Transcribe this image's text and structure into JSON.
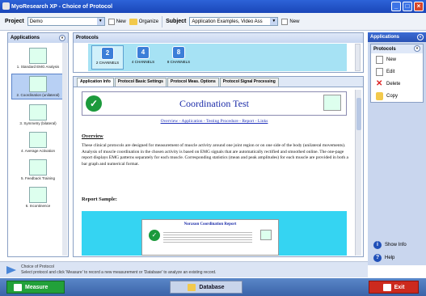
{
  "window": {
    "title": "MyoResearch XP - Choice of Protocol"
  },
  "toolbar": {
    "project_label": "Project",
    "project_value": "Demo",
    "new_label": "New",
    "organize_label": "Organize",
    "subject_label": "Subject",
    "subject_value": "Application Examples, Video Ass",
    "new2_label": "New"
  },
  "applications": {
    "header": "Applications",
    "items": [
      {
        "label": "1. Standard EMG Analysis"
      },
      {
        "label": "2. Coordination (unilateral)"
      },
      {
        "label": "3. Symmetry (bilateral)"
      },
      {
        "label": "4. Average Activation"
      },
      {
        "label": "5. Feedback Training"
      },
      {
        "label": "6. Incontinence"
      }
    ]
  },
  "protocols": {
    "header": "Protocols",
    "items": [
      {
        "label": "2 CHANNELS",
        "badge": "2"
      },
      {
        "label": "4 CHANNELS",
        "badge": "4"
      },
      {
        "label": "8 CHANNELS",
        "badge": "8"
      }
    ]
  },
  "tabs": [
    {
      "label": "Application Info"
    },
    {
      "label": "Protocol Basic Settings"
    },
    {
      "label": "Protocol Meas. Options"
    },
    {
      "label": "Protocol Signal Processing"
    }
  ],
  "content": {
    "title": "Coordination Test",
    "nav": "Overview - Application - Testing Procedure - Report - Links",
    "overview_heading": "Overview",
    "overview_text": "These clinical protocols are designed for measurement of muscle activity around one joint region or on one side of the body (unilateral movements). Analysis of muscle coordination in the chosen activity is based on EMG signals that are automatically rectified and smoothed online. The one-page report displays EMG patterns separately for each muscle. Corresponding statistics (mean and peak amplitudes) for each muscle are provided in both a bar graph and numerical format.",
    "report_heading": "Report Sample:",
    "report_title": "Noraxon Coordination Report"
  },
  "right_panel": {
    "header": "Applications",
    "sub_header": "Protocols",
    "actions": [
      {
        "label": "New"
      },
      {
        "label": "Edit"
      },
      {
        "label": "Delete"
      },
      {
        "label": "Copy"
      }
    ],
    "show_info": "Show Info",
    "help": "Help"
  },
  "hint": {
    "line1": "Choice of Protocol",
    "line2": "Select protocol and click 'Measure' to record a new measurement or 'Database' to analyze an existing record."
  },
  "bottom": {
    "measure": "Measure",
    "database": "Database",
    "exit": "Exit"
  },
  "colors": {
    "title_bar": "#2d63d8",
    "protocol_bg": "#a6e2f4",
    "measure": "#22a13a",
    "exit": "#cc2a1e"
  }
}
